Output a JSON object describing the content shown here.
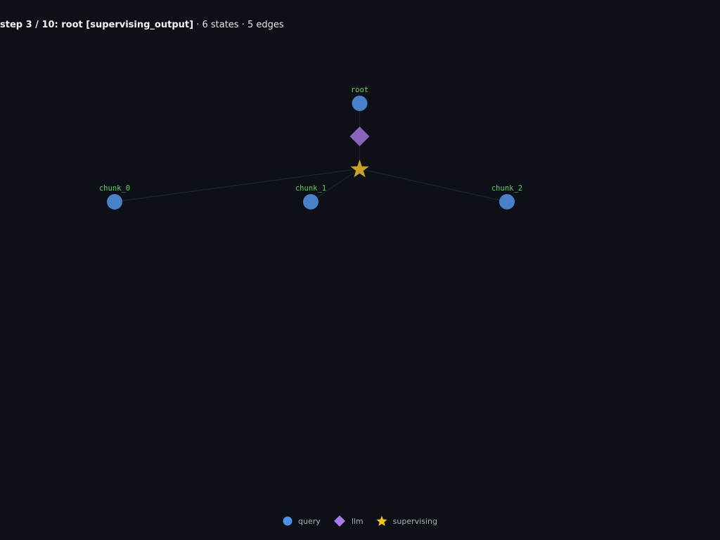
{
  "header": {
    "step_title": "step 3 / 10: root [supervising_output]",
    "stats": "· 6 states · 5 edges"
  },
  "colors": {
    "background": "#0d1017",
    "query": "#4a80c8",
    "llm": "#8a64b8",
    "supervising": "#c9a227",
    "label": "#5fd35f",
    "edge": "#1f232c",
    "legend_query": "#4e92e6",
    "legend_llm": "#a77be6",
    "legend_supervising": "#f0c419"
  },
  "nodes": [
    {
      "id": "root",
      "label": "root",
      "type": "query"
    },
    {
      "id": "llm_root",
      "label": "",
      "type": "llm"
    },
    {
      "id": "supervise_root",
      "label": "",
      "type": "supervising"
    },
    {
      "id": "chunk_0",
      "label": "chunk_0",
      "type": "query"
    },
    {
      "id": "chunk_1",
      "label": "chunk_1",
      "type": "query"
    },
    {
      "id": "chunk_2",
      "label": "chunk_2",
      "type": "query"
    }
  ],
  "edges": [
    {
      "from": "root",
      "to": "llm_root"
    },
    {
      "from": "llm_root",
      "to": "supervise_root"
    },
    {
      "from": "supervise_root",
      "to": "chunk_0"
    },
    {
      "from": "supervise_root",
      "to": "chunk_1"
    },
    {
      "from": "supervise_root",
      "to": "chunk_2"
    }
  ],
  "legend": [
    {
      "label": "query",
      "shape": "circle-icon"
    },
    {
      "label": "llm",
      "shape": "diamond-icon"
    },
    {
      "label": "supervising",
      "shape": "star-icon"
    }
  ]
}
